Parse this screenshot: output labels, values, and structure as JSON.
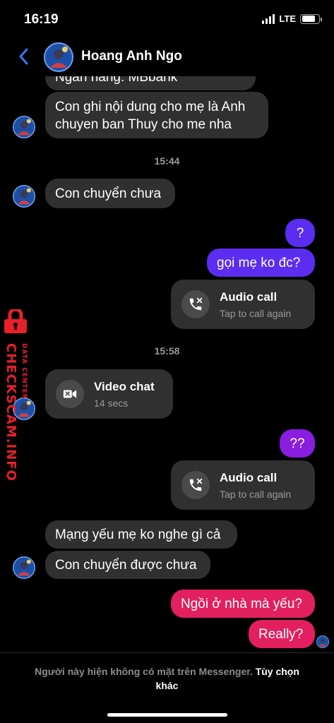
{
  "status_bar": {
    "time": "16:19",
    "network": "LTE",
    "battery_level": 0.8
  },
  "header": {
    "contact_name": "Hoang Anh Ngo",
    "back_icon": "chevron-left-icon"
  },
  "messages": [
    {
      "sender": "contact",
      "text": "Ngân hàng: MBbank"
    },
    {
      "sender": "contact",
      "text": "Con ghi nội dung cho mẹ là Anh chuyen ban Thuy cho me nha"
    },
    {
      "type": "timestamp",
      "text": "15:44"
    },
    {
      "sender": "contact",
      "text": "Con chuyển chưa"
    },
    {
      "sender": "me",
      "text": "?"
    },
    {
      "sender": "me",
      "text": "gọi mẹ ko đc?"
    },
    {
      "sender": "me",
      "type": "call",
      "title": "Audio call",
      "subtitle": "Tap to call again",
      "icon": "missed-call-icon"
    },
    {
      "type": "timestamp",
      "text": "15:58"
    },
    {
      "sender": "contact",
      "type": "call",
      "title": "Video chat",
      "subtitle": "14 secs",
      "icon": "video-camera-icon"
    },
    {
      "sender": "me",
      "text": "??"
    },
    {
      "sender": "me",
      "type": "call",
      "title": "Audio call",
      "subtitle": "Tap to call again",
      "icon": "missed-call-icon"
    },
    {
      "sender": "contact",
      "text": "Mạng yếu mẹ ko nghe gì cả"
    },
    {
      "sender": "contact",
      "text": "Con chuyển được chưa"
    },
    {
      "sender": "me",
      "text": "Ngồi ở nhà mà yếu?"
    },
    {
      "sender": "me",
      "text": "Really?"
    }
  ],
  "watermark": {
    "main": "CHECKSCAM.INFO",
    "sub": "DATA CENTER"
  },
  "footer": {
    "notice": "Người này hiện không có mặt trên Messenger.",
    "link": "Tùy chọn khác"
  },
  "colors": {
    "bubble_incoming": "#303030",
    "bubble_blue": "#5a2df0",
    "bubble_purple": "#8a1ee0",
    "bubble_pink": "#e2205f",
    "accent_back": "#2f7bf5",
    "watermark_red": "#e8202a"
  }
}
